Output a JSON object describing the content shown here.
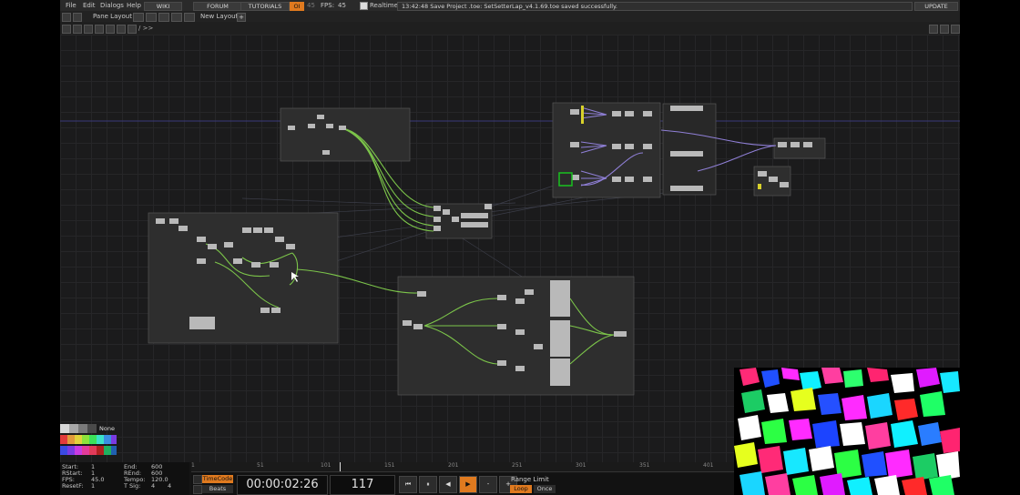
{
  "menu": {
    "file": "File",
    "edit": "Edit",
    "dialogs": "Dialogs",
    "help": "Help",
    "wiki": "WIKI",
    "forum": "FORUM",
    "tutorials": "TUTORIALS",
    "oi": "OI",
    "num45": "45",
    "fps_label": "FPS:",
    "fps_value": "45",
    "realtime": "Realtime",
    "status_message": "13:42:48 Save Project .toe: SetSetterLap_v4.1.69.toe saved successfully.",
    "update": "UPDATE"
  },
  "toolbar": {
    "pane_layout": "Pane Layout",
    "new_layout": "New Layout",
    "plus": "+",
    "path": "/ >>"
  },
  "timeline": {
    "ticks": [
      "1",
      "51",
      "101",
      "151",
      "201",
      "251",
      "301",
      "351",
      "401"
    ]
  },
  "info": {
    "start_label": "Start:",
    "start": "1",
    "end_label": "End:",
    "end": "600",
    "rstart_label": "RStart:",
    "rstart": "1",
    "rend_label": "REnd:",
    "rend": "600",
    "fps_label": "FPS:",
    "fps": "45.0",
    "tempo_label": "Tempo:",
    "tempo": "120.0",
    "resetf_label": "ResetF:",
    "resetf": "1",
    "tsig_label": "T Sig:",
    "tsig_a": "4",
    "tsig_b": "4"
  },
  "transport": {
    "timecode_btn": "TimeCode",
    "beats_btn": "Beats",
    "timecode": "00:00:02:26",
    "frame": "117",
    "range_limit": "Range Limit",
    "loop": "Loop",
    "once": "Once",
    "minus": "-",
    "plus": "+"
  },
  "palette": {
    "none": "None"
  },
  "colors": {
    "accent": "#e07a1f",
    "wire_green": "#7cc54a",
    "wire_purple": "#8f7fd6",
    "selected": "#19c21f"
  }
}
